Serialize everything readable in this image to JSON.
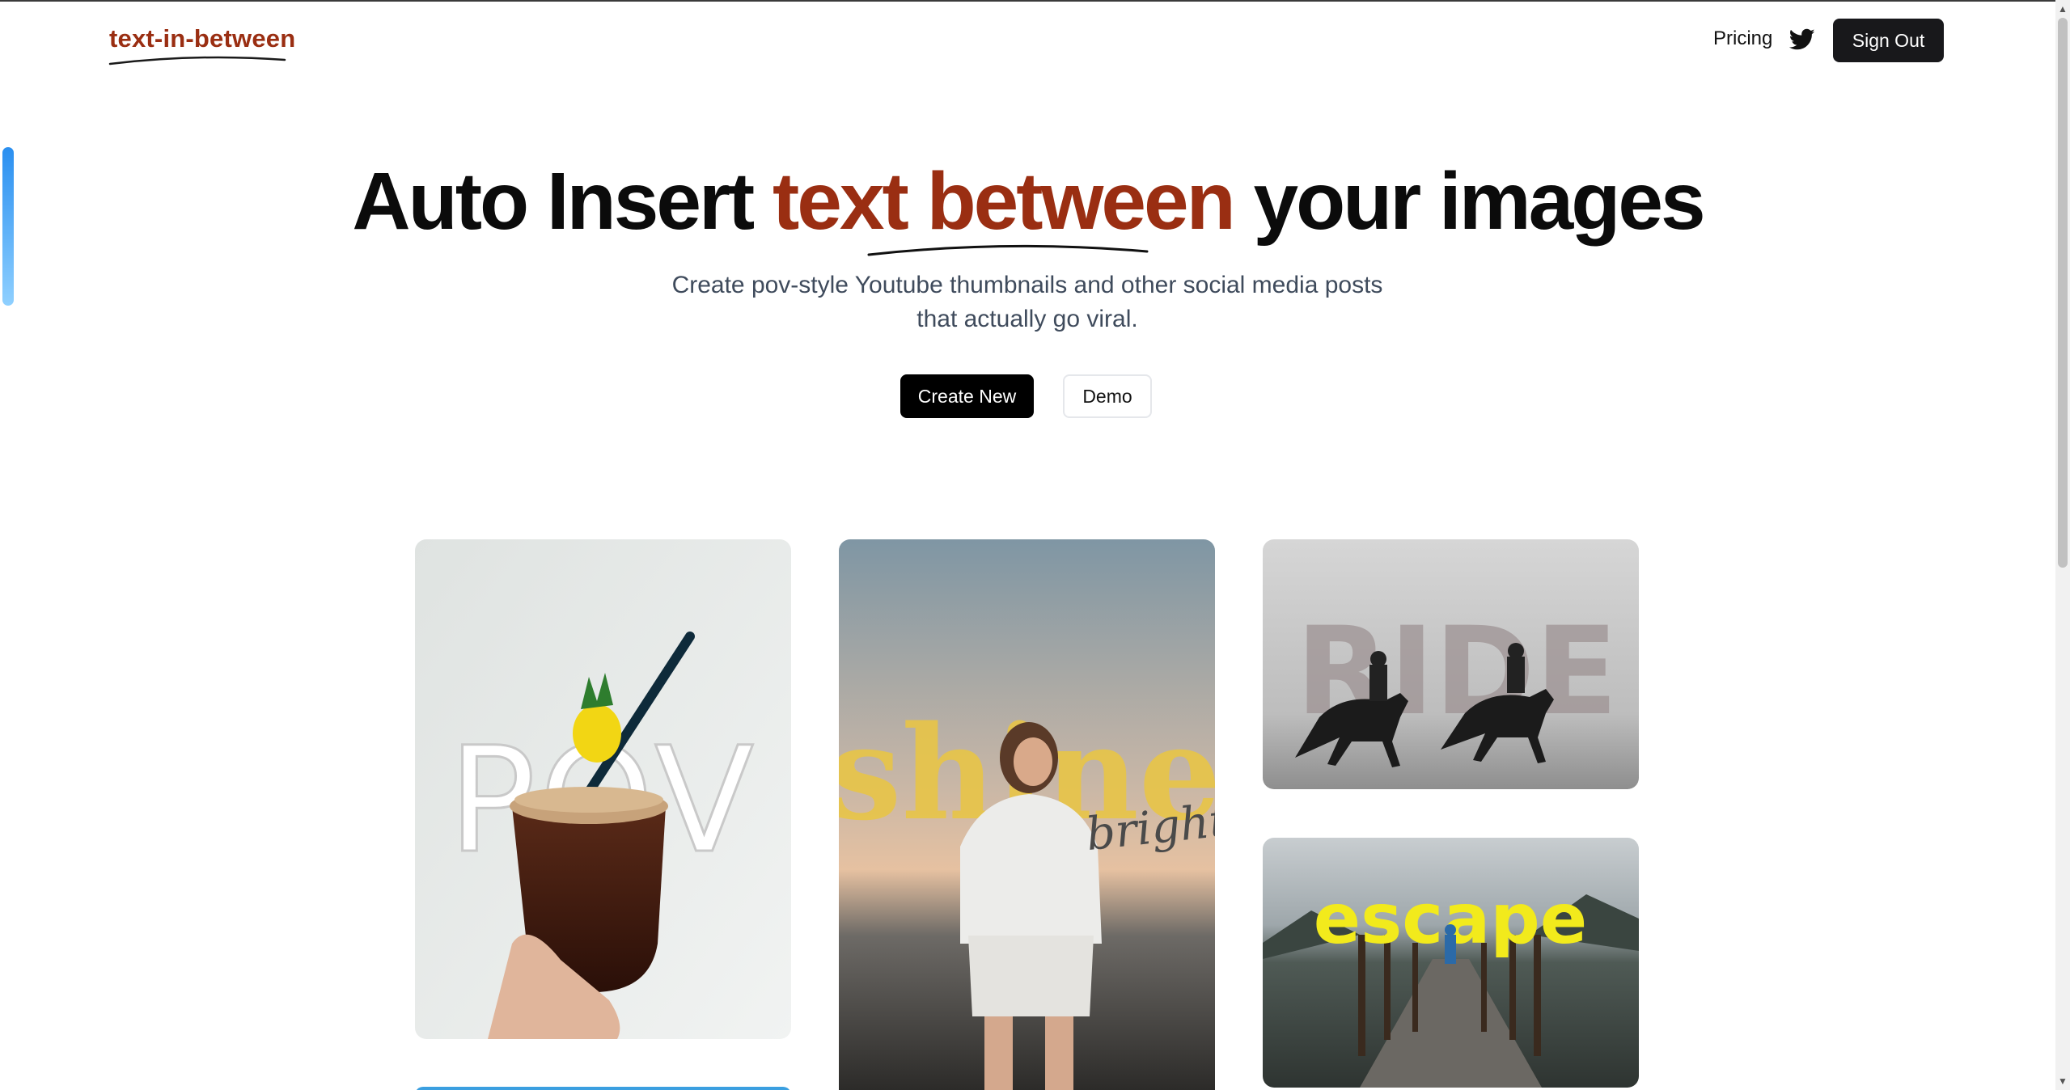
{
  "header": {
    "logo": "text-in-between",
    "nav": {
      "pricing": "Pricing",
      "twitter_icon": "twitter-icon",
      "sign_out": "Sign Out"
    }
  },
  "hero": {
    "title_start": "Auto Insert ",
    "title_accent": "text between",
    "title_end": " your images",
    "subtitle_line1": "Create pov-style Youtube thumbnails and other social media posts",
    "subtitle_line2": "that actually go viral.",
    "create_button": "Create New",
    "demo_button": "Demo"
  },
  "gallery": {
    "items": [
      {
        "word": "POV"
      },
      {
        "word": "shine",
        "secondary": "bright"
      },
      {
        "word": "RIDE"
      },
      {
        "word": "escape"
      }
    ]
  },
  "colors": {
    "brand": "#9a2e12",
    "button_dark": "#18181b",
    "subtitle": "#3f4b5c",
    "shine_text": "#e8c547",
    "escape_text": "#f2ea1c"
  }
}
